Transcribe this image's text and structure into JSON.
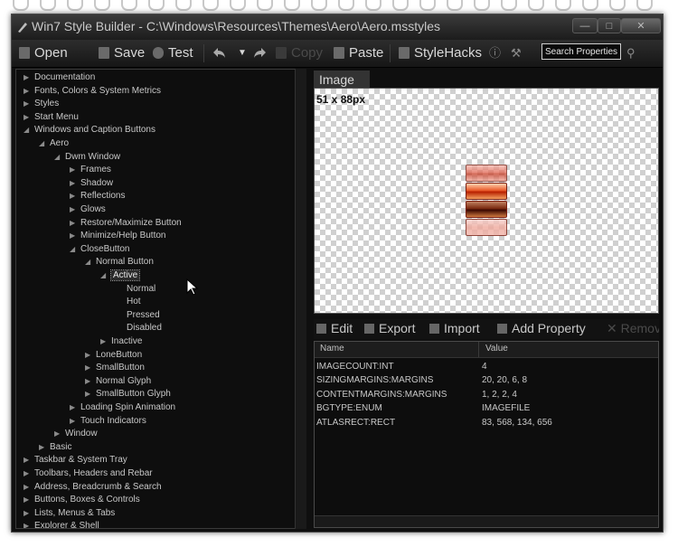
{
  "window": {
    "title": "Win7 Style Builder - C:\\Windows\\Resources\\Themes\\Aero\\Aero.msstyles",
    "minimize": "—",
    "maximize": "□",
    "close": "✕"
  },
  "toolbar": {
    "open": "Open",
    "save": "Save",
    "test": "Test",
    "copy": "Copy",
    "paste": "Paste",
    "stylehacks": "StyleHacks",
    "search_placeholder": "Search Properties"
  },
  "tree": {
    "items": [
      {
        "label": "Documentation",
        "arrow": "▶"
      },
      {
        "label": "Fonts, Colors & System Metrics",
        "arrow": "▶"
      },
      {
        "label": "Styles",
        "arrow": "▶"
      },
      {
        "label": "Start Menu",
        "arrow": "▶"
      },
      {
        "label": "Windows and Caption Buttons",
        "arrow": "◢"
      },
      {
        "label": "Aero",
        "arrow": "◢"
      },
      {
        "label": "Dwm Window",
        "arrow": "◢"
      },
      {
        "label": "Frames",
        "arrow": "▶"
      },
      {
        "label": "Shadow",
        "arrow": "▶"
      },
      {
        "label": "Reflections",
        "arrow": "▶"
      },
      {
        "label": "Glows",
        "arrow": "▶"
      },
      {
        "label": "Restore/Maximize Button",
        "arrow": "▶"
      },
      {
        "label": "Minimize/Help Button",
        "arrow": "▶"
      },
      {
        "label": "CloseButton",
        "arrow": "◢"
      },
      {
        "label": "Normal Button",
        "arrow": "◢"
      },
      {
        "label": "Active",
        "arrow": "◢"
      },
      {
        "label": "Normal",
        "arrow": ""
      },
      {
        "label": "Hot",
        "arrow": ""
      },
      {
        "label": "Pressed",
        "arrow": ""
      },
      {
        "label": "Disabled",
        "arrow": ""
      },
      {
        "label": "Inactive",
        "arrow": "▶"
      },
      {
        "label": "LoneButton",
        "arrow": "▶"
      },
      {
        "label": "SmallButton",
        "arrow": "▶"
      },
      {
        "label": "Normal Glyph",
        "arrow": "▶"
      },
      {
        "label": "SmallButton Glyph",
        "arrow": "▶"
      },
      {
        "label": "Loading Spin Animation",
        "arrow": "▶"
      },
      {
        "label": "Touch Indicators",
        "arrow": "▶"
      },
      {
        "label": "Window",
        "arrow": "▶"
      },
      {
        "label": "Basic",
        "arrow": "▶"
      },
      {
        "label": "Taskbar & System Tray",
        "arrow": "▶"
      },
      {
        "label": "Toolbars, Headers and Rebar",
        "arrow": "▶"
      },
      {
        "label": "Address, Breadcrumb & Search",
        "arrow": "▶"
      },
      {
        "label": "Buttons, Boxes & Controls",
        "arrow": "▶"
      },
      {
        "label": "Lists, Menus & Tabs",
        "arrow": "▶"
      },
      {
        "label": "Explorer & Shell",
        "arrow": "▶"
      }
    ]
  },
  "image_panel": {
    "tab": "Image",
    "dimensions": "51 x 88px"
  },
  "properties": {
    "edit": "Edit",
    "export": "Export",
    "import": "Import",
    "add_property": "Add Property",
    "remove": "Remove",
    "col_name": "Name",
    "col_value": "Value",
    "rows": [
      {
        "name": "IMAGECOUNT:INT",
        "value": "4"
      },
      {
        "name": "SIZINGMARGINS:MARGINS",
        "value": "20, 20, 6, 8"
      },
      {
        "name": "CONTENTMARGINS:MARGINS",
        "value": "1, 2, 2, 4"
      },
      {
        "name": "BGTYPE:ENUM",
        "value": "IMAGEFILE"
      },
      {
        "name": "ATLASRECT:RECT",
        "value": "83, 568, 134, 656"
      }
    ]
  }
}
